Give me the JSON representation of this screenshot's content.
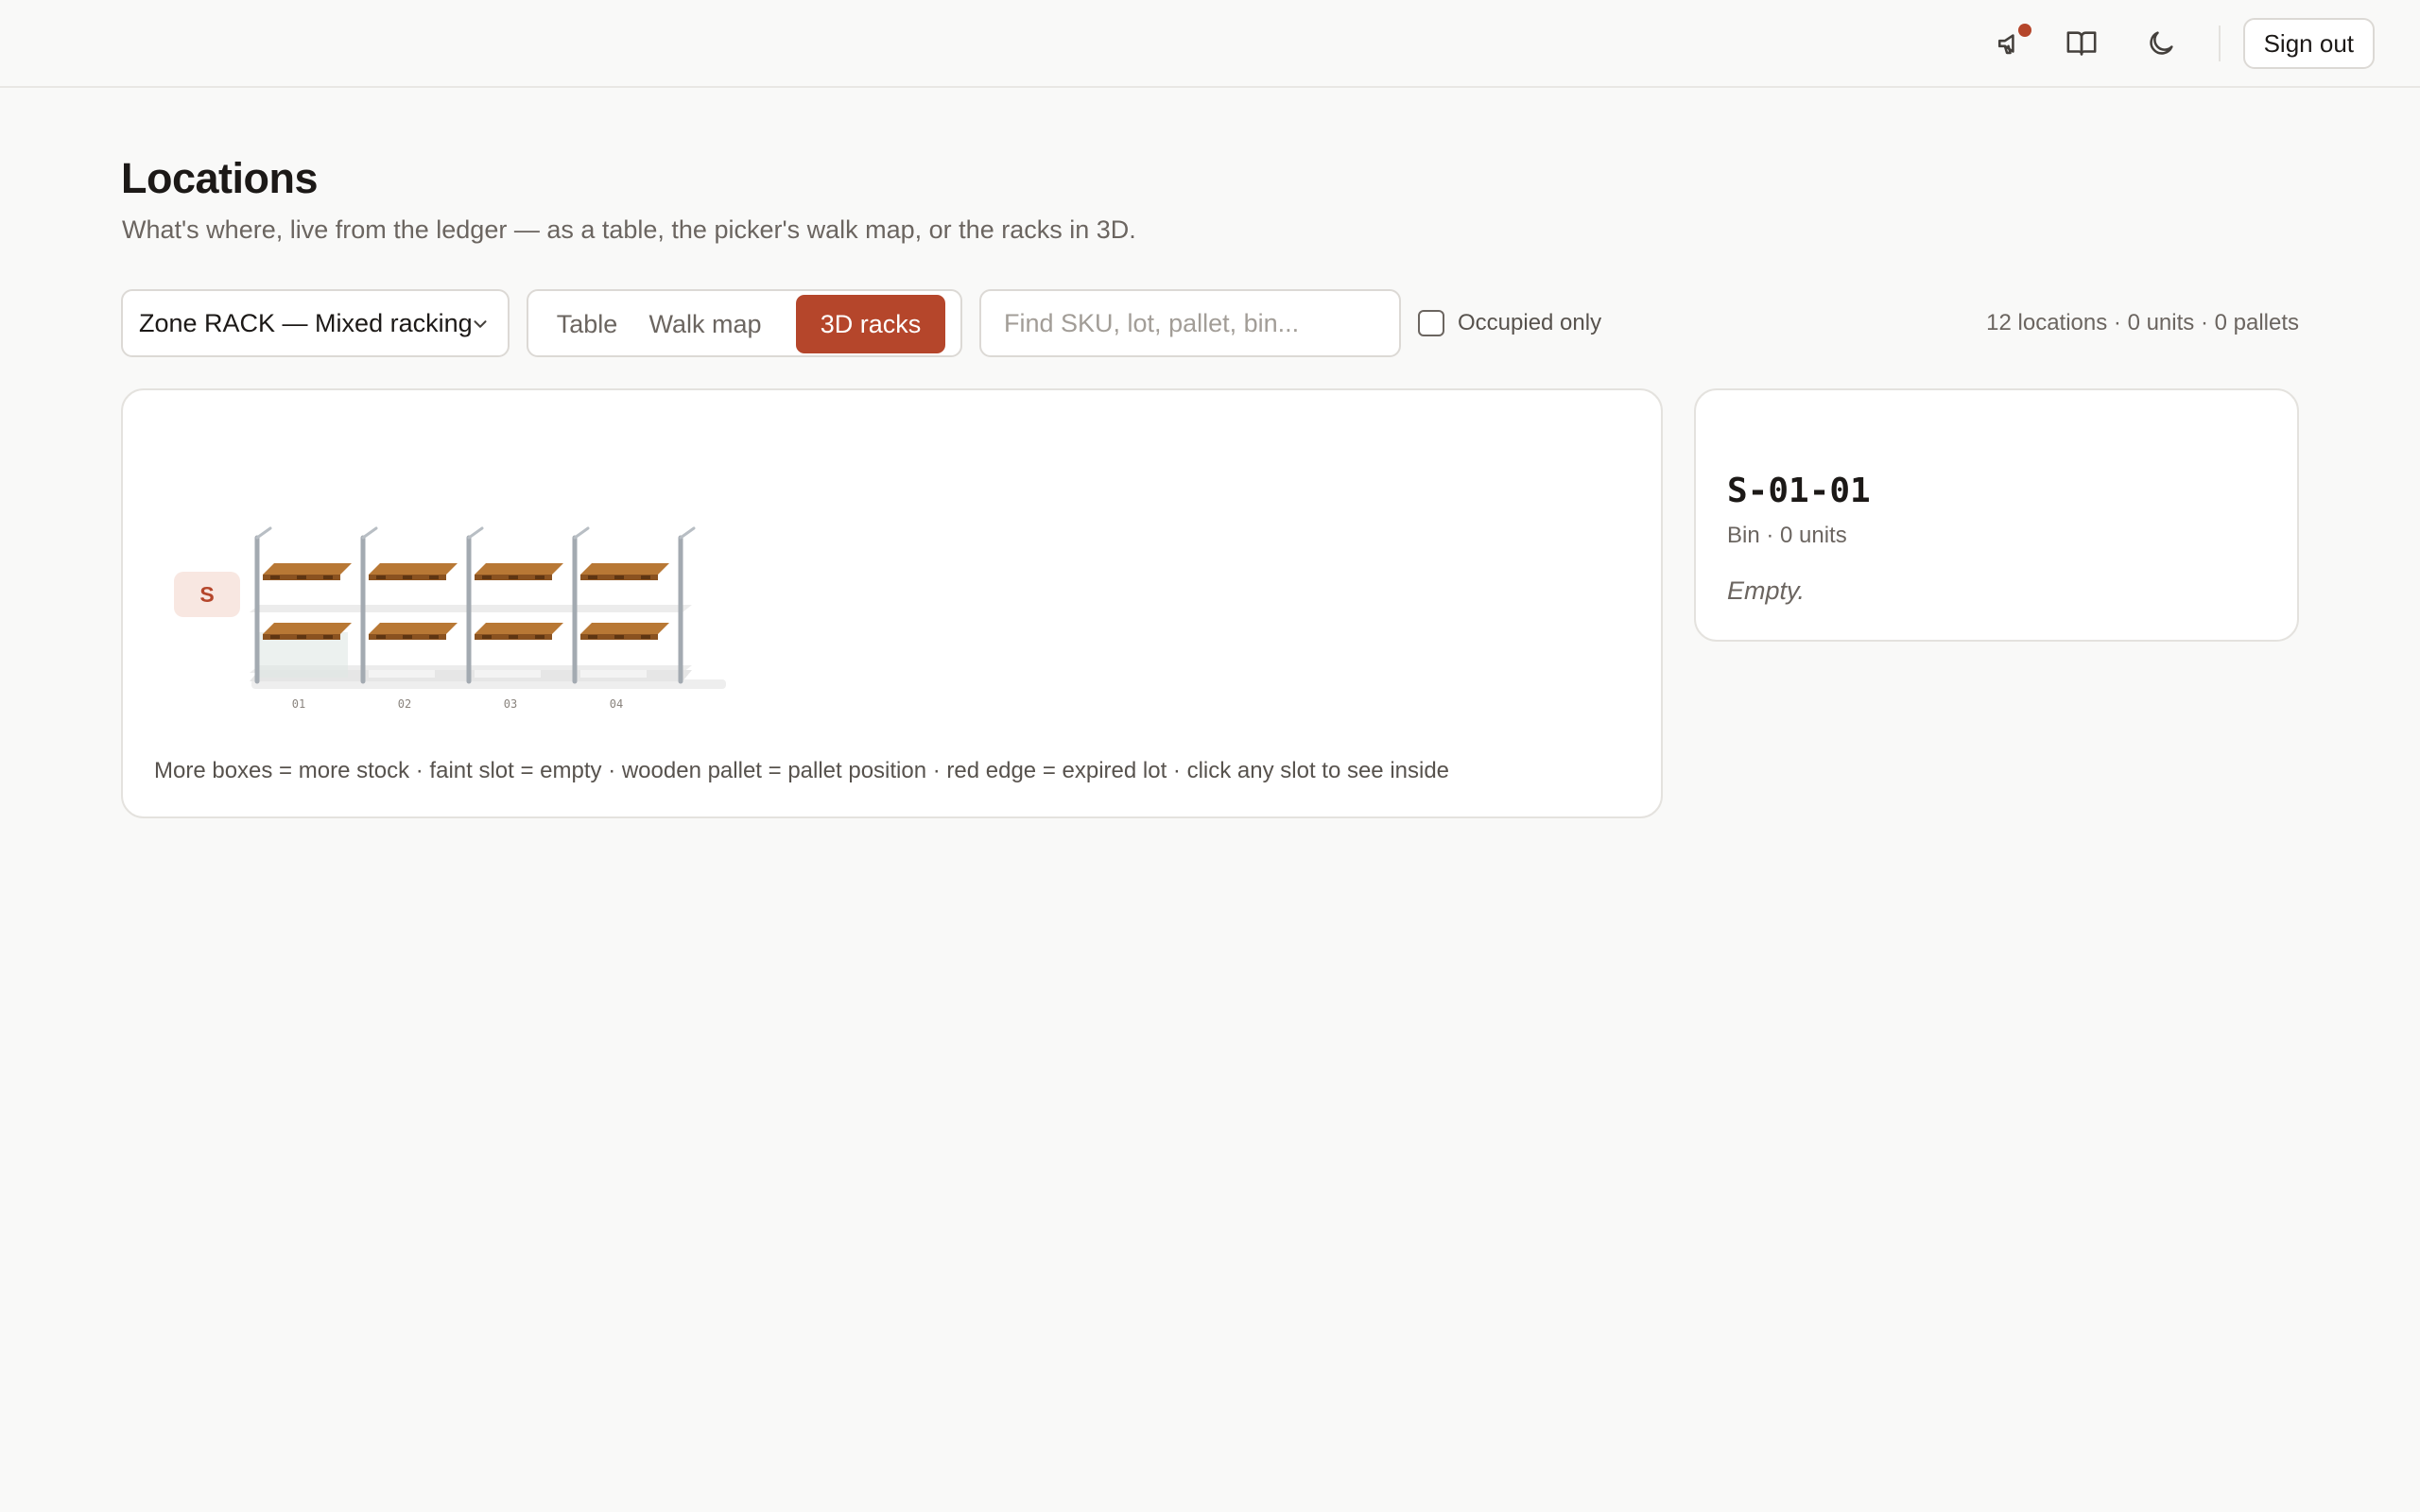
{
  "header": {
    "sign_out_label": "Sign out",
    "icons": [
      "megaphone-icon",
      "book-icon",
      "moon-icon"
    ],
    "notification_dot": true
  },
  "page": {
    "title": "Locations",
    "subtitle": "What's where, live from the ledger — as a table, the picker's walk map, or the racks in 3D."
  },
  "toolbar": {
    "zone_select_value": "Zone RACK — Mixed racking",
    "view_tabs": [
      {
        "label": "Table",
        "active": false
      },
      {
        "label": "Walk map",
        "active": false
      },
      {
        "label": "3D racks",
        "active": true
      }
    ],
    "search_placeholder": "Find SKU, lot, pallet, bin...",
    "occupied_only_label": "Occupied only",
    "occupied_only_checked": false,
    "stats": "12 locations · 0 units · 0 pallets"
  },
  "rack_view": {
    "aisle_badge": "S",
    "bay_labels": [
      "01",
      "02",
      "03",
      "04"
    ],
    "legend": "More boxes = more stock · faint slot = empty · wooden pallet = pallet position · red edge = expired lot · click any slot to see inside"
  },
  "detail": {
    "bin_code": "S-01-01",
    "bin_meta": "Bin · 0 units",
    "contents": "Empty."
  },
  "colors": {
    "accent": "#b5462b",
    "background": "#f9f9f8",
    "pallet_wood": "#a4672a"
  }
}
